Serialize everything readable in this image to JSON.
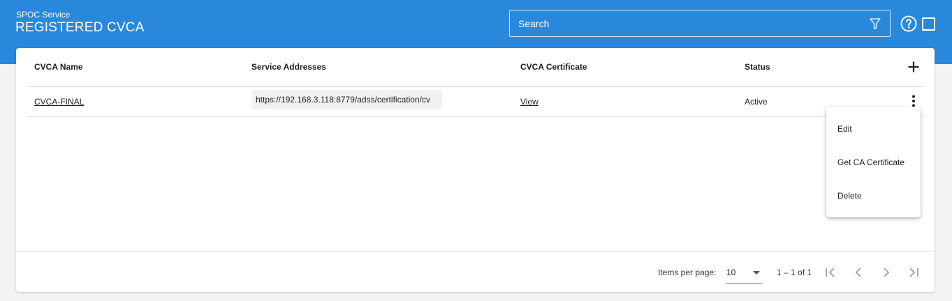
{
  "header": {
    "app_subtitle": "SPOC Service",
    "page_title": "REGISTERED CVCA",
    "search": {
      "placeholder": "Search",
      "value": ""
    },
    "accent_color": "#2a88dc"
  },
  "table": {
    "columns": [
      "CVCA Name",
      "Service Addresses",
      "CVCA Certificate",
      "Status"
    ],
    "rows": [
      {
        "name": "CVCA-FINAL",
        "service_address": "https://192.168.3.118:8779/adss/certification/cv",
        "certificate_link": "View",
        "status": "Active"
      }
    ]
  },
  "context_menu": {
    "items": [
      "Edit",
      "Get CA Certificate",
      "Delete"
    ]
  },
  "paginator": {
    "items_per_page_label": "Items per page:",
    "items_per_page": "10",
    "range_label": "1 – 1 of 1"
  },
  "icons": {
    "filter": "filter-icon",
    "help": "help-icon",
    "fullscreen": "fullscreen-icon",
    "add": "add-icon",
    "more": "more-vert-icon",
    "first_page": "first-page-icon",
    "prev_page": "prev-page-icon",
    "next_page": "next-page-icon",
    "last_page": "last-page-icon"
  }
}
